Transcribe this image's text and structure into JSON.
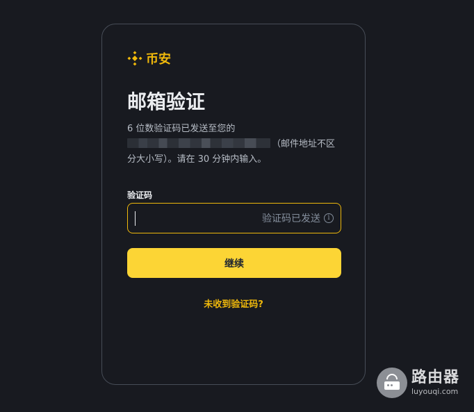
{
  "brand": {
    "name": "币安",
    "color": "#f0b90b",
    "logo_icon": "binance-diamond-icon"
  },
  "page": {
    "title": "邮箱验证",
    "description_line1": "6 位数验证码已发送至您的",
    "description_rest": "（邮件地址不区分大小写）。请在 30 分钟内输入。"
  },
  "form": {
    "code_label": "验证码",
    "code_value": "",
    "sent_status": "验证码已发送",
    "info_icon": "info-icon",
    "continue_label": "继续",
    "resend_link": "未收到验证码?"
  },
  "colors": {
    "background": "#181a20",
    "accent": "#fcd535",
    "focus_border": "#f0b90b"
  },
  "watermark": {
    "title": "路由器",
    "domain": "luyouqi.com"
  }
}
